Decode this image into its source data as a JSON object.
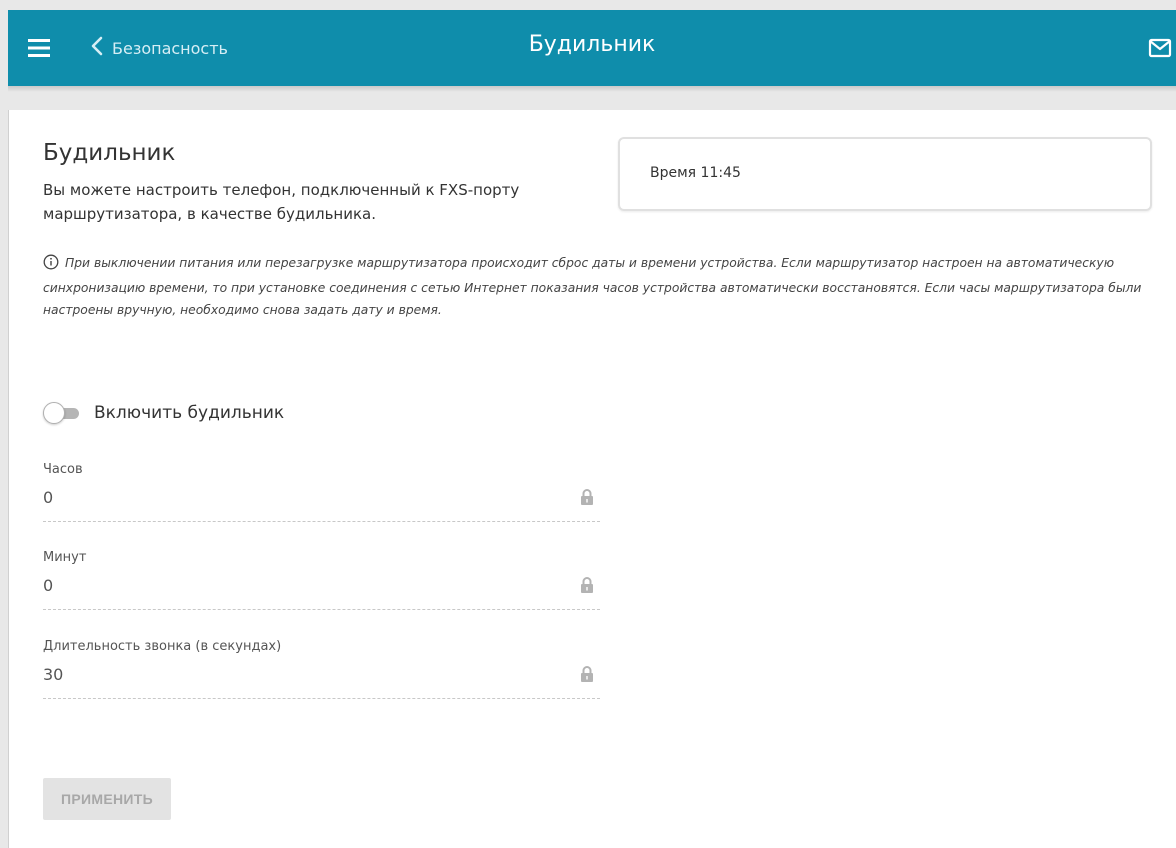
{
  "header": {
    "back_label": "Безопасность",
    "title": "Будильник",
    "menu_icon": "hamburger-menu-icon",
    "back_icon": "chevron-left-icon",
    "mail_icon": "mail-icon",
    "color": "#0f8dab"
  },
  "page": {
    "title": "Будильник",
    "description": "Вы можете настроить телефон, подключенный к FXS-порту маршрутизатора, в качестве будильника.",
    "time_label": "Время 11:45",
    "notice": "При выключении питания или перезагрузке маршрутизатора происходит сброс даты и времени устройства. Если маршрутизатор настроен на автоматическую синхронизацию времени, то при установке соединения с сетью Интернет показания часов устройства автоматически восстановятся. Если часы маршрутизатора были настроены вручную, необходимо снова задать дату и время."
  },
  "toggle": {
    "label": "Включить будильник",
    "enabled": false
  },
  "fields": {
    "hours": {
      "label": "Часов",
      "value": "0",
      "locked": true
    },
    "minutes": {
      "label": "Минут",
      "value": "0",
      "locked": true
    },
    "duration": {
      "label": "Длительность звонка (в секундах)",
      "value": "30",
      "locked": true
    }
  },
  "apply_button": {
    "label": "ПРИМЕНИТЬ",
    "disabled": true
  }
}
